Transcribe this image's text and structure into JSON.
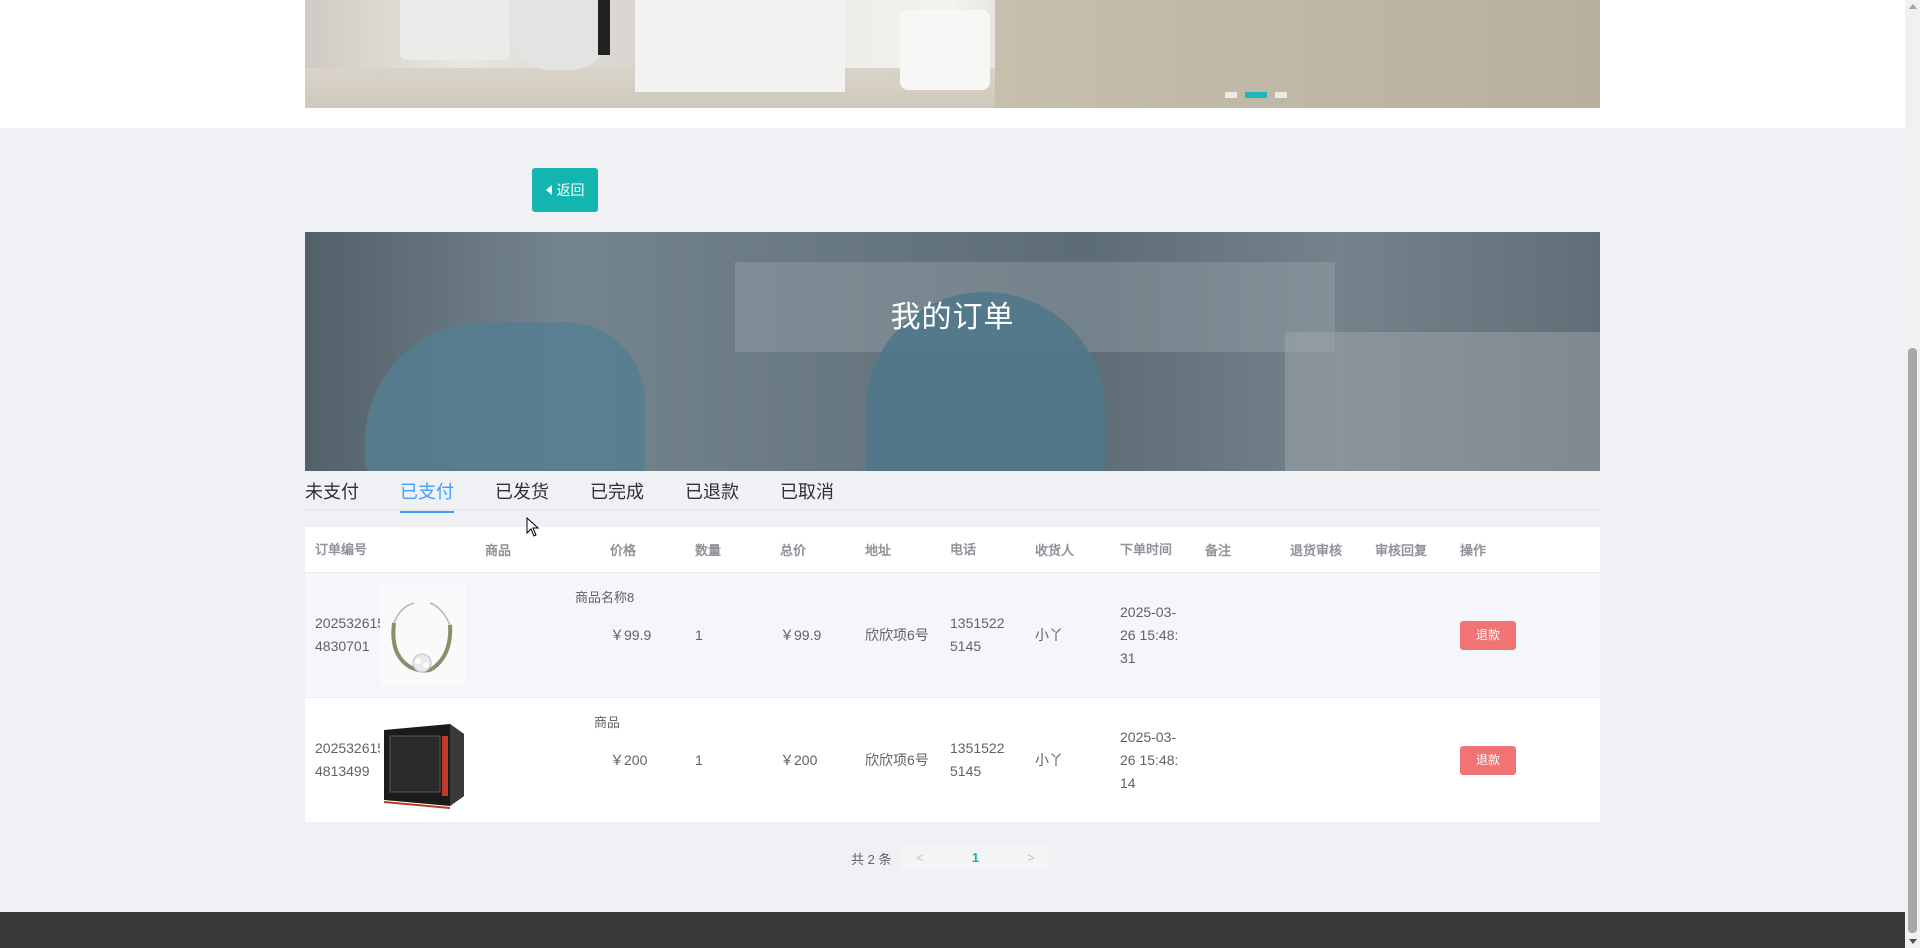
{
  "back_button": {
    "label": "返回",
    "icon": "caret-left-icon"
  },
  "banner": {
    "title": "我的订单"
  },
  "carousel": {
    "dots": 3,
    "active_index": 1,
    "accent": "#1fb5bc"
  },
  "tabs": [
    {
      "label": "未支付",
      "active": false
    },
    {
      "label": "已支付",
      "active": true
    },
    {
      "label": "已发货",
      "active": false
    },
    {
      "label": "已完成",
      "active": false
    },
    {
      "label": "已退款",
      "active": false
    },
    {
      "label": "已取消",
      "active": false
    }
  ],
  "table": {
    "headers": [
      "订单编号",
      "商品",
      "价格",
      "数量",
      "总价",
      "地址",
      "电话",
      "收货人",
      "下单时间",
      "备注",
      "退货审核",
      "审核回复",
      "操作"
    ],
    "rows": [
      {
        "order_no": "2025326154830701",
        "order_no_l1": "202532615",
        "order_no_l2": "4830701",
        "goods_name": "商品名称8",
        "goods_image": "bracelet-image",
        "price": "￥99.9",
        "qty": "1",
        "total": "￥99.9",
        "address": "欣欣项6号",
        "tel_l1": "1351522",
        "tel_l2": "5145",
        "receiver": "小丫",
        "time_l1": "2025-03-",
        "time_l2": "26 15:48:",
        "time_l3": "31",
        "note": "",
        "audit": "",
        "reply": "",
        "action": "退款"
      },
      {
        "order_no": "2025326154813499",
        "order_no_l1": "202532615",
        "order_no_l2": "4813499",
        "goods_name": "商品",
        "goods_image": "microwave-image",
        "price": "￥200",
        "qty": "1",
        "total": "￥200",
        "address": "欣欣项6号",
        "tel_l1": "1351522",
        "tel_l2": "5145",
        "receiver": "小丫",
        "time_l1": "2025-03-",
        "time_l2": "26 15:48:",
        "time_l3": "14",
        "note": "",
        "audit": "",
        "reply": "",
        "action": "退款"
      }
    ]
  },
  "pagination": {
    "total_text": "共 2 条",
    "prev": "<",
    "current": "1",
    "next": ">"
  },
  "colors": {
    "primary": "#13b5b1",
    "tab_active": "#409eff",
    "danger": "#f07474",
    "footer": "#3a3a3a"
  }
}
